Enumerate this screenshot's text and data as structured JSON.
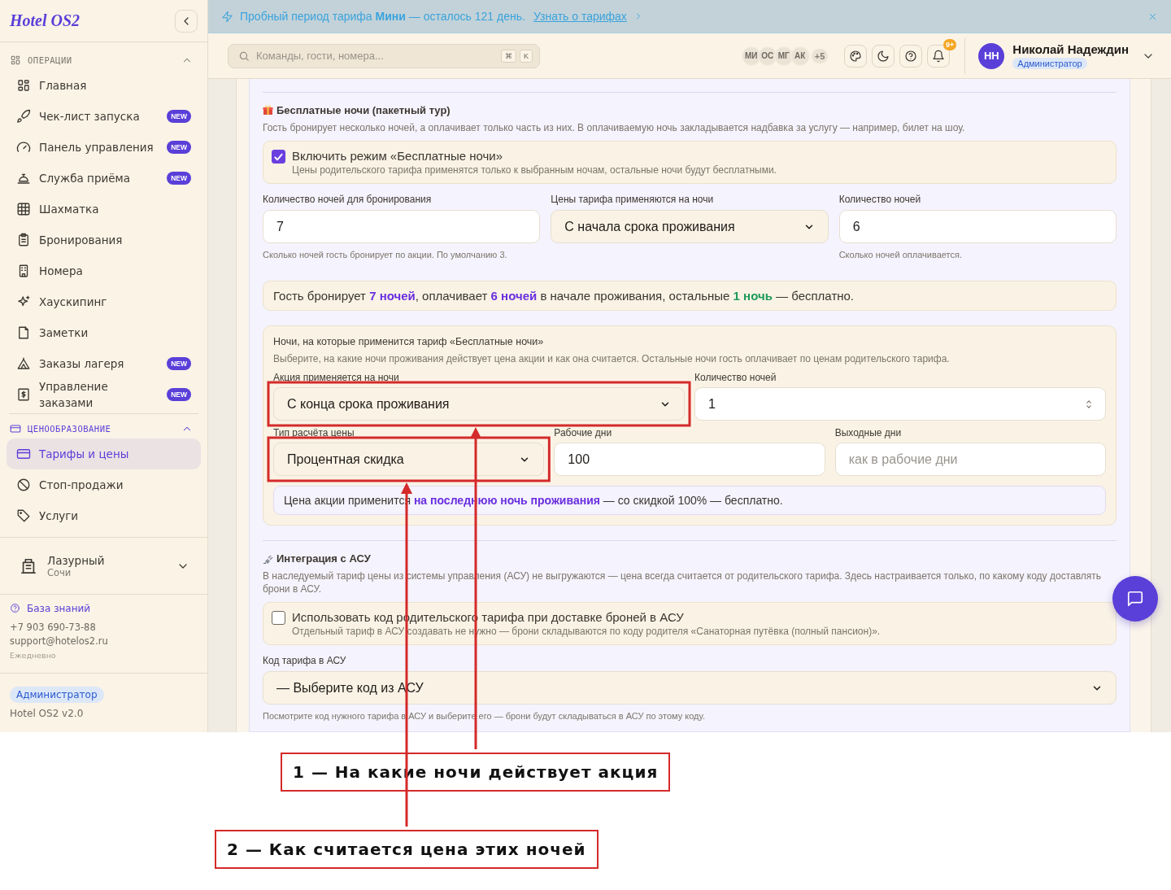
{
  "sidebar": {
    "logo": "Hotel OS2",
    "sections": [
      {
        "title": "ОПЕРАЦИИ",
        "expanded": true,
        "items": [
          {
            "label": "Главная",
            "selected": false
          },
          {
            "label": "Чек-лист запуска",
            "badge": "NEW",
            "selected": false
          },
          {
            "label": "Панель управления",
            "badge": "NEW",
            "selected": false
          },
          {
            "label": "Служба приёма",
            "badge": "NEW",
            "selected": false
          },
          {
            "label": "Шахматка",
            "selected": false
          },
          {
            "label": "Бронирования",
            "selected": false
          },
          {
            "label": "Номера",
            "selected": false
          },
          {
            "label": "Хаускипинг",
            "selected": false
          },
          {
            "label": "Заметки",
            "selected": false
          },
          {
            "label": "Заказы лагеря",
            "badge": "NEW",
            "selected": false
          },
          {
            "label": "Управление заказами",
            "badge": "NEW",
            "selected": false
          }
        ]
      },
      {
        "title": "ЦЕНООБРАЗОВАНИЕ",
        "expanded": true,
        "items": [
          {
            "label": "Тарифы и цены",
            "selected": true
          },
          {
            "label": "Стоп-продажи",
            "selected": false
          },
          {
            "label": "Услуги",
            "selected": false
          }
        ]
      }
    ],
    "property": {
      "name": "Лазурный",
      "city": "Сочи"
    },
    "support": {
      "link": "База знаний",
      "phone": "+7 903 690-73-88",
      "email": "support@hotelos2.ru",
      "hours": "Ежедневно"
    },
    "role": "Администратор",
    "version": "Hotel OS2 v2.0"
  },
  "banner": {
    "text": "Пробный период тарифа **Мини** — осталось 121 день.",
    "link": "Узнать о тарифах"
  },
  "topbar": {
    "search": {
      "placeholder": "Команды, гости, номера...",
      "keys": [
        "⌘",
        "K"
      ]
    },
    "presence": {
      "avatars": [
        "МИ",
        "ОС",
        "МГ",
        "АК"
      ],
      "more": "+5"
    },
    "notifications": "9+",
    "user": {
      "initials": "НН",
      "name": "Николай Надеждин",
      "role": "Администратор"
    }
  },
  "free_nights": {
    "title": "Бесплатные ночи (пакетный тур)",
    "description": "Гость бронирует несколько ночей, а оплачивает только часть из них. В оплачиваемую ночь закладывается надбавка за услугу — например, билет на шоу.",
    "toggle": {
      "label": "Включить режим «Бесплатные ночи»",
      "hint": "Цены родительского тарифа применятся только к выбранным ночам, остальные ночи будут бесплатными.",
      "checked": true
    },
    "rows": [
      {
        "fields": [
          {
            "label": "Количество ночей для бронирования",
            "kind": "number",
            "value": "7",
            "helper": "Сколько ночей гость бронирует по акции. По умолчанию 3.",
            "highlighted": false
          },
          {
            "label": "Цены тарифа применяются на ночи",
            "kind": "select",
            "value": "С начала срока проживания",
            "highlighted": false
          },
          {
            "label": "Количество ночей",
            "kind": "number",
            "value": "6",
            "helper": "Сколько ночей оплачивается.",
            "highlighted": false
          }
        ]
      }
    ],
    "summary": [
      {
        "text": "Гость бронирует ",
        "kind": "plain"
      },
      {
        "text": "7 ночей",
        "kind": "accent"
      },
      {
        "text": ", оплачивает ",
        "kind": "plain"
      },
      {
        "text": "6 ночей",
        "kind": "accent"
      },
      {
        "text": " в начале проживания, остальные ",
        "kind": "plain"
      },
      {
        "text": "1 ночь",
        "kind": "success"
      },
      {
        "text": " — бесплатно.",
        "kind": "plain"
      }
    ]
  },
  "nights_rule": {
    "title": "Ночи, на которые применится тариф «Бесплатные ночи»",
    "description": "Выберите, на какие ночи проживания действует цена акции и как она считается. Остальные ночи гость оплачивает по ценам родительского тарифа.",
    "rows": [
      {
        "fields": [
          {
            "label": "Акция применяется на ночи",
            "kind": "select",
            "value": "С конца срока проживания",
            "highlighted": true
          },
          {
            "label": "Количество ночей",
            "kind": "spinner",
            "value": "1",
            "highlighted": false
          }
        ]
      },
      {
        "fields": [
          {
            "label": "Тип расчёта цены",
            "kind": "select",
            "value": "Процентная скидка",
            "highlighted": true
          },
          {
            "label": "Рабочие дни",
            "kind": "number",
            "value": "100",
            "highlighted": false
          },
          {
            "label": "Выходные дни",
            "kind": "number",
            "placeholder": "как в рабочие дни",
            "highlighted": false
          }
        ]
      }
    ],
    "info": [
      {
        "text": "Цена акции применится ",
        "kind": "plain"
      },
      {
        "text": "на последнюю ночь проживания",
        "kind": "accent"
      },
      {
        "text": " — со скидкой 100% — бесплатно.",
        "kind": "plain"
      }
    ]
  },
  "integration": {
    "title": "Интеграция с АСУ",
    "description": "В наследуемый тариф цены из системы управления (АСУ) не выгружаются — цена всегда считается от родительского тарифа. Здесь настраивается только, по какому коду доставлять брони в АСУ.",
    "toggle": {
      "label": "Использовать код родительского тарифа при доставке броней в АСУ",
      "hint": "Отдельный тариф в АСУ создавать не нужно — брони складываются по коду родителя «Санаторная путёвка (полный пансион)».",
      "checked": false
    },
    "rows": [
      {
        "fields": [
          {
            "label": "Код тарифа в АСУ",
            "kind": "select",
            "value": "— Выберите код из АСУ",
            "helper": "Посмотрите код нужного тарифа в АСУ и выберите его — брони будут складываться в АСУ по этому коду.",
            "highlighted": false
          }
        ]
      }
    ]
  },
  "annotations": [
    {
      "label": "1 — На какие ночи действует акция"
    },
    {
      "label": "2 — Как считается цена этих ночей"
    }
  ]
}
